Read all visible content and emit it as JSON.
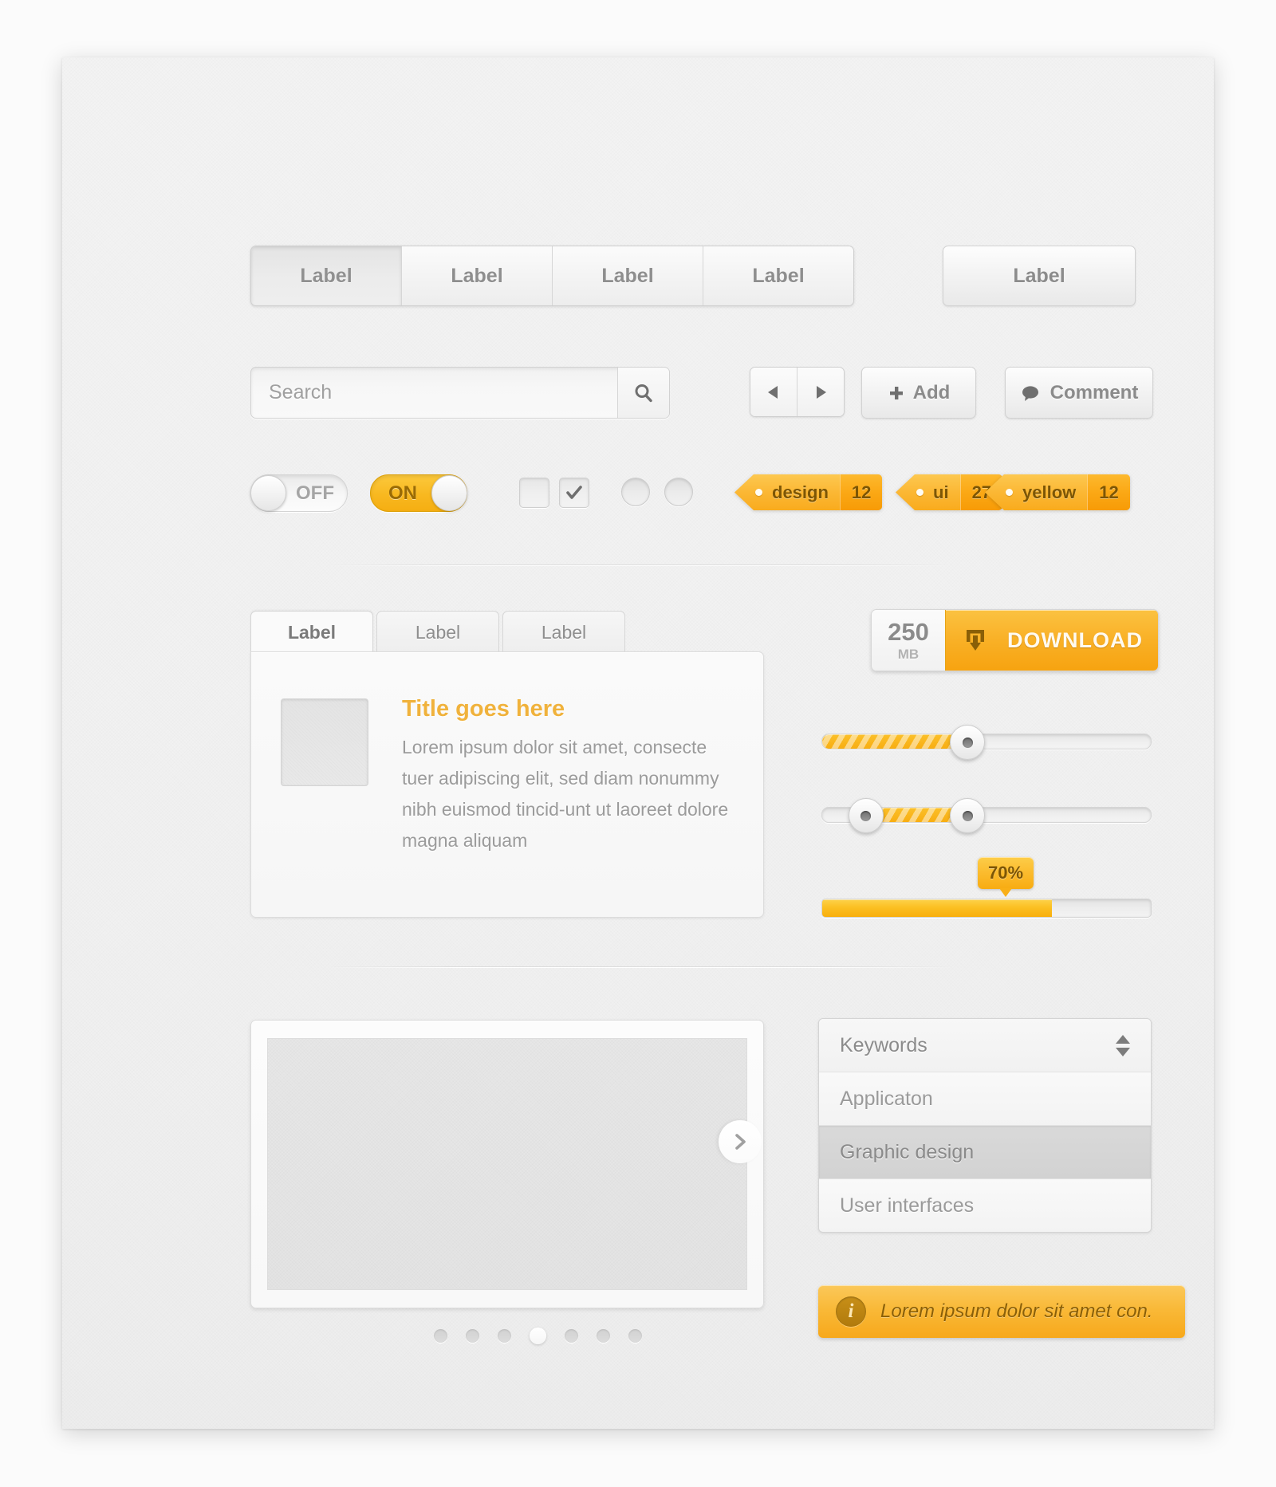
{
  "button_group": {
    "items": [
      {
        "label": "Label",
        "state": "pressed"
      },
      {
        "label": "Label",
        "state": "normal"
      },
      {
        "label": "Label",
        "state": "normal"
      },
      {
        "label": "Label",
        "state": "normal"
      }
    ],
    "standalone": {
      "label": "Label"
    }
  },
  "search": {
    "value": "",
    "placeholder": "Search",
    "icon": "search-icon"
  },
  "nav": {
    "prev_icon": "triangle-left-icon",
    "next_icon": "triangle-right-icon",
    "add_label": "Add",
    "add_icon": "plus-icon",
    "comment_label": "Comment",
    "comment_icon": "speech-bubble-icon"
  },
  "toggles": {
    "off_label": "OFF",
    "on_label": "ON"
  },
  "checks": {
    "checkmark": "✔"
  },
  "tags": [
    {
      "name": "design",
      "count": "12"
    },
    {
      "name": "ui",
      "count": "27"
    },
    {
      "name": "yellow",
      "count": "12"
    }
  ],
  "tab_panel": {
    "tabs": [
      {
        "label": "Label",
        "active": true
      },
      {
        "label": "Label",
        "active": false
      },
      {
        "label": "Label",
        "active": false
      }
    ],
    "title": "Title goes here",
    "body": "Lorem ipsum dolor sit amet, consecte tuer adipiscing elit, sed diam nonummy nibh euismod tincid-unt ut laoreet dolore magna aliquam"
  },
  "download": {
    "size_number": "250",
    "size_unit": "MB",
    "label": "DOWNLOAD",
    "icon": "download-tray-icon"
  },
  "sliders": [
    {
      "name": "single-handle-slider",
      "fill_start_pct": 0,
      "fill_end_pct": 44,
      "handles": [
        44
      ]
    },
    {
      "name": "range-slider",
      "fill_start_pct": 13,
      "fill_end_pct": 44,
      "handles": [
        13,
        44
      ]
    }
  ],
  "progress": {
    "value_label": "70%",
    "value_pct": 70
  },
  "carousel": {
    "next_icon": "chevron-right-icon",
    "dots_count": 7,
    "active_dot_index": 3
  },
  "listbox": {
    "items": [
      {
        "label": "Keywords",
        "type": "header",
        "selected": false
      },
      {
        "label": "Applicaton",
        "type": "option",
        "selected": false
      },
      {
        "label": "Graphic design",
        "type": "option",
        "selected": true
      },
      {
        "label": "User interfaces",
        "type": "option",
        "selected": false
      }
    ],
    "spinner_icon": "spinner-up-down-icon"
  },
  "notice": {
    "icon": "info-icon",
    "icon_glyph": "i",
    "text": "Lorem ipsum dolor sit amet con."
  },
  "colors": {
    "accent": "#f9b02a",
    "accent_dark": "#f7a310",
    "title": "#f0b23c",
    "text_gray": "#9a9a9a",
    "panel_bg": "#f1f1f1"
  }
}
